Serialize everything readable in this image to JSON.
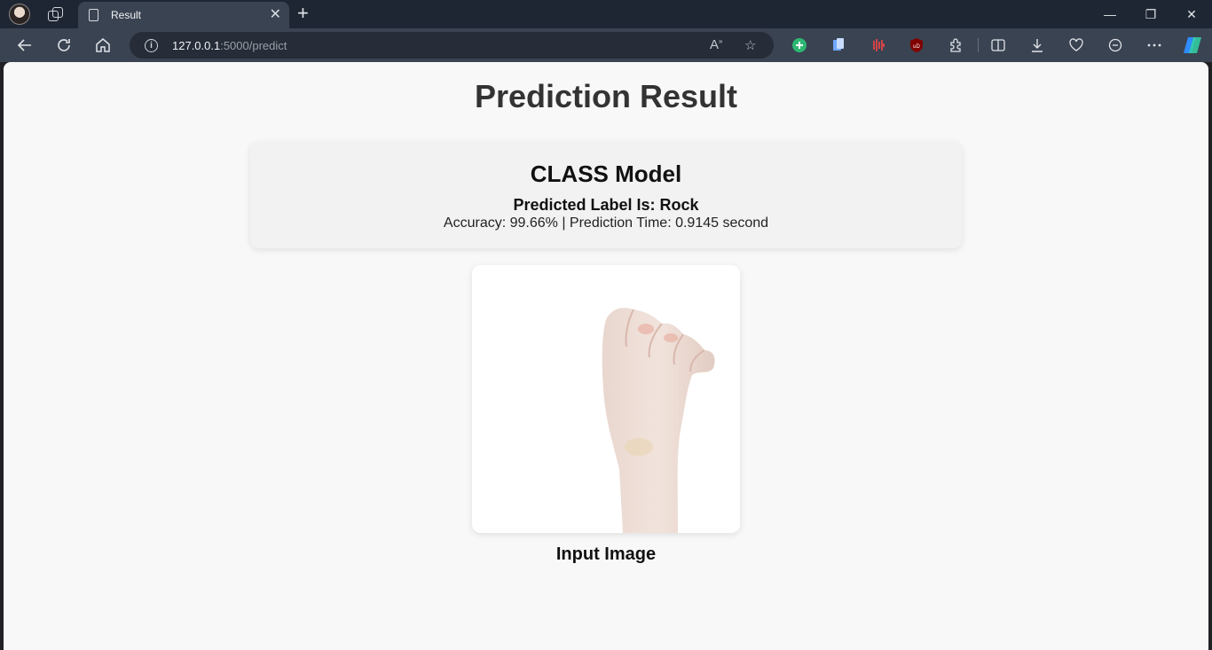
{
  "browser": {
    "tab_title": "Result",
    "tab_close": "✕",
    "new_tab": "+",
    "url_host": "127.0.0.1",
    "url_rest": ":5000/predict",
    "minimize": "—",
    "restore": "❐",
    "close": "✕",
    "icons": [
      "back-icon",
      "refresh-icon",
      "home-icon",
      "info-icon",
      "read-aloud-icon",
      "favorite-star-icon",
      "add-extension-icon",
      "collections-icon",
      "audio-extension-icon",
      "ublock-icon",
      "extensions-icon",
      "split-screen-icon",
      "downloads-icon",
      "browser-essentials-icon",
      "copilot-app-icon",
      "more-icon",
      "copilot-icon"
    ]
  },
  "page": {
    "title": "Prediction Result",
    "model_title": "CLASS Model",
    "predicted_label": "Predicted Label Is: Rock",
    "metrics": "Accuracy: 99.66% | Prediction Time: 0.9145 second",
    "image_caption": "Input Image"
  }
}
